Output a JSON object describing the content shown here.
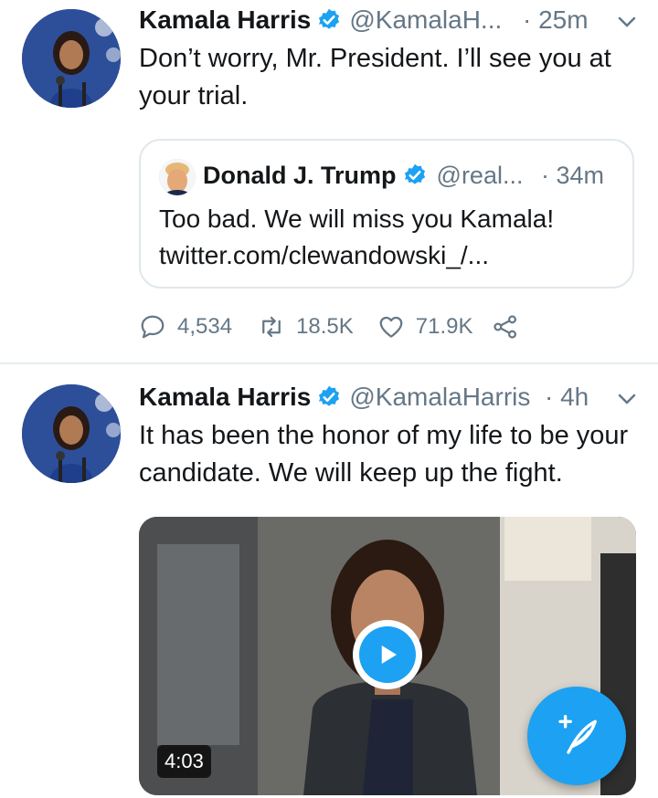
{
  "tweets": [
    {
      "name": "Kamala Harris",
      "handle": "@KamalaH...",
      "time": "· 25m",
      "text": "Don’t worry, Mr. President. I’ll see you at your trial.",
      "quote": {
        "name": "Donald J. Trump",
        "handle": "@real...",
        "time": "· 34m",
        "text": "Too bad. We will miss you Kamala! twitter.com/clewandowski_/..."
      },
      "replies": "4,534",
      "retweets": "18.5K",
      "likes": "71.9K"
    },
    {
      "name": "Kamala Harris",
      "handle": "@KamalaHarris",
      "time": "· 4h",
      "text": "It has been the honor of my life to be your candidate. We will keep up the fight.",
      "video_duration": "4:03"
    }
  ],
  "colors": {
    "accent": "#1da1f2",
    "secondary_text": "#657786",
    "border": "#e1e8ed"
  },
  "icons": {
    "verified": "verified-badge-icon",
    "caret": "chevron-down-icon",
    "reply": "reply-icon",
    "retweet": "retweet-icon",
    "like": "heart-icon",
    "share": "share-icon",
    "play": "play-icon",
    "compose": "compose-tweet-icon"
  }
}
